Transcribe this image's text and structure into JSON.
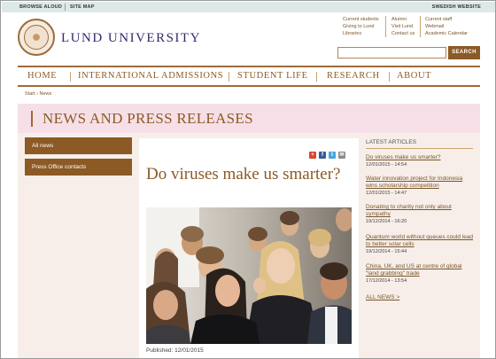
{
  "utility": {
    "browse_aloud": "BROWSE ALOUD",
    "site_map": "SITE MAP",
    "swedish": "SWEDISH WEBSITE"
  },
  "brand": {
    "name": "LUND UNIVERSITY"
  },
  "quick_links": {
    "col1": [
      "Current students",
      "Giving to Lund",
      "Libraries"
    ],
    "col2": [
      "Alumni",
      "Visit Lund",
      "Contact us"
    ],
    "col3": [
      "Current staff",
      "Webmail",
      "Academic Calendar"
    ]
  },
  "search": {
    "button": "SEARCH",
    "value": ""
  },
  "nav": [
    "HOME",
    "INTERNATIONAL ADMISSIONS",
    "STUDENT LIFE",
    "RESEARCH",
    "ABOUT"
  ],
  "breadcrumb": "Start › News",
  "page_title": "NEWS AND PRESS RELEASES",
  "left_nav": [
    "All news",
    "Press Office contacts"
  ],
  "article": {
    "title": "Do viruses make us smarter?",
    "published": "Published: 12/01/2015"
  },
  "sidebar": {
    "title": "LATEST ARTICLES",
    "articles": [
      {
        "title": "Do viruses make us smarter?",
        "date": "12/01/2015 - 14:54"
      },
      {
        "title": "Water innovation project for Indonesia wins scholarship competition",
        "date": "12/01/2015 - 14:47"
      },
      {
        "title": "Donating to charity not only about sympathy",
        "date": "19/12/2014 - 16:20"
      },
      {
        "title": "Quantum world without queues could lead to better solar cells",
        "date": "19/12/2014 - 15:44"
      },
      {
        "title": "China, UK, and US at centre of global \"land grabbing\" trade",
        "date": "17/12/2014 - 13:54"
      }
    ],
    "all_news": "ALL NEWS"
  },
  "colors": {
    "brand_brown": "#8c5a25",
    "brand_navy": "#2f2a6e",
    "banner_pink": "#f6dfe7",
    "utility_bar": "#dde9e9"
  },
  "share_icons": [
    "google-plus-icon",
    "facebook-icon",
    "twitter-icon",
    "email-icon"
  ]
}
